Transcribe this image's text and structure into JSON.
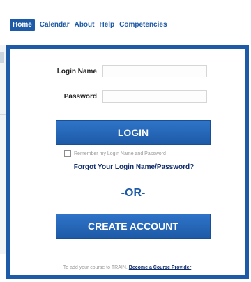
{
  "nav": {
    "home": "Home",
    "items": [
      "Calendar",
      "About",
      "Help",
      "Competencies"
    ]
  },
  "login": {
    "login_name_label": "Login Name",
    "password_label": "Password",
    "login_name_value": "",
    "password_value": "",
    "login_button": "LOGIN",
    "remember_text": "Remember my Login Name and Password",
    "forgot_link": "Forgot Your Login Name/Password?",
    "or_text": "-OR-",
    "create_button": "CREATE ACCOUNT"
  },
  "footer": {
    "prefix": "To add your course to TRAIN,",
    "link": "Become a Course Provider"
  },
  "colors": {
    "brand_blue": "#1d5aa7",
    "link_dark": "#102d6b"
  }
}
